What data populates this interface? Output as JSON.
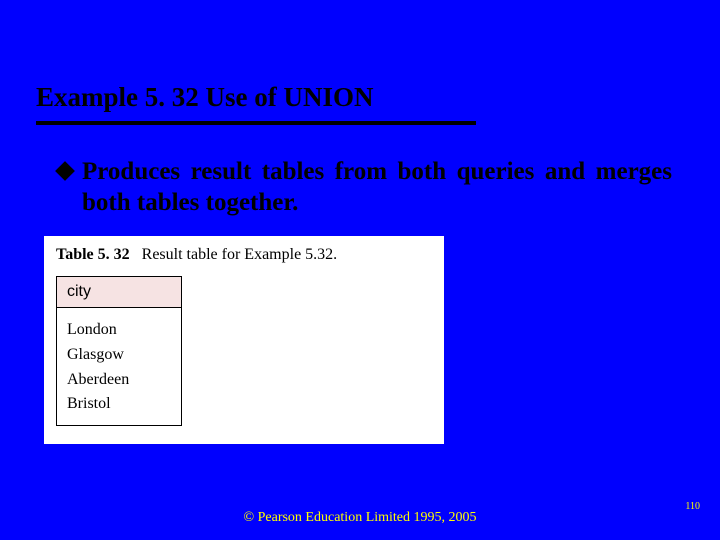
{
  "title": "Example 5. 32  Use of UNION",
  "bullet": "Produces result tables from both queries and merges both tables together.",
  "figure": {
    "caption_bold": "Table 5. 32",
    "caption_rest": "Result table for Example 5.32.",
    "header": "city",
    "rows": [
      "London",
      "Glasgow",
      "Aberdeen",
      "Bristol"
    ]
  },
  "footer": "© Pearson Education Limited 1995, 2005",
  "page_number": "110"
}
